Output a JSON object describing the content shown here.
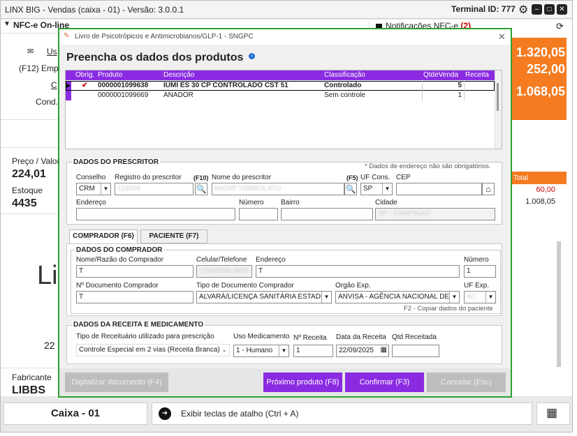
{
  "app": {
    "title": "LINX BIG - Vendas (caixa - 01) - Versão: 3.0.0.1",
    "terminal": "Terminal ID: 777"
  },
  "left": {
    "nfce": "NFC-e On-line",
    "user_label": "Us",
    "f12": "(F12) Emp",
    "c_label": "C",
    "cond": "Cond.",
    "price_label": "Preço / Valor",
    "price_value": "224,01",
    "stock_label": "Estoque",
    "stock_value": "4435",
    "big_text": "Li",
    "num22": "22",
    "fab_label": "Fabricante",
    "fab_value": "LIBBS"
  },
  "right": {
    "notif": "Notificações NFC-e",
    "notif_count": "(2)",
    "v1": "1.320,05",
    "v2": "252,00",
    "v3": "1.068,05",
    "total_label": "Total",
    "t1": "60,00",
    "t2": "1.008,05"
  },
  "bottom": {
    "caixa": "Caixa - 01",
    "shortcut": "Exibir teclas de atalho (Ctrl + A)"
  },
  "modal": {
    "title": "Livro de Psicotrópicos e Antimicrobianos/GLP-1 - SNGPC",
    "heading": "Preencha os dados dos produtos",
    "grid": {
      "headers": [
        "Obrig.",
        "Produto",
        "Descrição",
        "Classificação",
        "QtdeVenda",
        "Receita"
      ],
      "rows": [
        {
          "check": "✔",
          "produto": "0000001099638",
          "descricao": "IUMI ES 30 CP CONTROLADO CST 51",
          "classificacao": "Controlado",
          "qtde": "5",
          "receita": ""
        },
        {
          "check": "",
          "produto": "0000001099669",
          "descricao": "ANADOR",
          "classificacao": "Sem controle",
          "qtde": "1",
          "receita": ""
        }
      ]
    },
    "prescritor": {
      "title": "DADOS DO PRESCRITOR",
      "note": "* Dados de endereço não são obrigatórios.",
      "conselho_label": "Conselho",
      "conselho_value": "CRM",
      "registro_label": "Registro do prescritor",
      "registro_value": "123456",
      "f10": "(F10)",
      "nome_label": "Nome do prescritor",
      "nome_value": "NADIR TOMBOLATO",
      "f5": "(F5)",
      "uf_label": "UF Cons.",
      "uf_value": "SP",
      "cep_label": "CEP",
      "cep_value": "",
      "endereco_label": "Endereço",
      "endereco_value": "",
      "numero_label": "Número",
      "numero_value": "",
      "bairro_label": "Bairro",
      "bairro_value": "",
      "cidade_label": "Cidade",
      "cidade_value": "SP - CAMPINAS"
    },
    "tabs": [
      "COMPRADOR (F6)",
      "PACIENTE (F7)"
    ],
    "comprador": {
      "title": "DADOS DO COMPRADOR",
      "nome_label": "Nome/Razão do Comprador",
      "nome_value": "T",
      "celular_label": "Celular/Telefone",
      "celular_value": "(19)99999-9999",
      "endereco_label": "Endereço",
      "endereco_value": "T",
      "numero_label": "Número",
      "numero_value": "1",
      "doc_label": "Nº Documento Comprador",
      "doc_value": "T",
      "tipodoc_label": "Tipo de Documento Comprador",
      "tipodoc_value": "ALVARÁ/LICENÇA SANITÁRIA ESTADU",
      "orgao_label": "Orgão Exp.",
      "orgao_value": "ANVISA - AGÊNCIA NACIONAL DE V",
      "ufexp_label": "UF Exp.",
      "ufexp_value": "AC",
      "copy_hint": "F2 - Copiar dados do paciente"
    },
    "receita": {
      "title": "DADOS DA RECEITA E MEDICAMENTO",
      "tipo_label": "Tipo de Receituário utilizado para prescrição",
      "tipo_value": "Controle Especial em 2 vias (Receita Branca)",
      "uso_label": "Uso Medicamento",
      "uso_value": "1 - Humano",
      "nreceita_label": "Nº Receita",
      "nreceita_value": "1",
      "data_label": "Data da Receita",
      "data_value": "22/09/2025",
      "qtd_label": "Qtd Receitada",
      "qtd_value": ""
    },
    "buttons": {
      "digitalizar": "Digitalizar documento (F4)",
      "proximo": "Próximo produto (F8)",
      "confirmar": "Confirmar (F3)",
      "cancelar": "Cancelar (Esc)"
    }
  },
  "colors": {
    "purple": "#8a2be2",
    "orange": "#f47b20",
    "green_border": "#2ea02e",
    "red": "#cc0000"
  }
}
